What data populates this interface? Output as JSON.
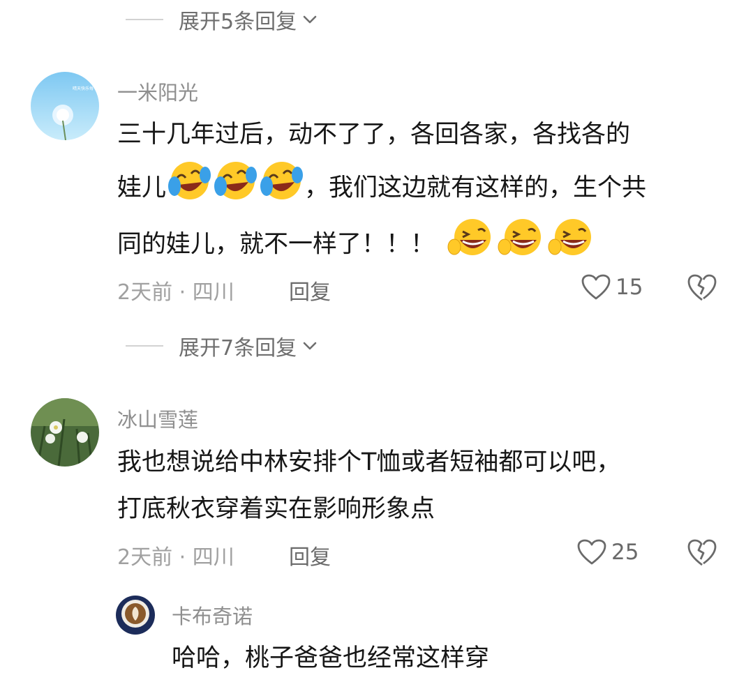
{
  "replies_expand": [
    {
      "label": "展开5条回复"
    },
    {
      "label": "展开7条回复"
    }
  ],
  "comments": [
    {
      "username": "一米阳光",
      "lines": [
        "三十几年过后，动不了了，各回各家，各找各的",
        "，我们这边就有这样的，生个共",
        "同的娃儿，就不一样了！！！"
      ],
      "line2_prefix": "娃儿",
      "meta": "2天前 · 四川",
      "reply": "回复",
      "likes": "15",
      "avatar_caption": "晴天快乐每一天"
    },
    {
      "username": "冰山雪莲",
      "lines": [
        "我也想说给中林安排个T恤或者短袖都可以吧，",
        "打底秋衣穿着实在影响形象点"
      ],
      "meta": "2天前 · 四川",
      "reply": "回复",
      "likes": "25"
    },
    {
      "username": "卡布奇诺",
      "lines": [
        "哈哈，桃子爸爸也经常这样穿"
      ]
    }
  ],
  "icons": {
    "like": "heart-outline-icon",
    "dislike": "broken-heart-icon",
    "expand": "chevron-down-icon",
    "laugh_cry": "tears-of-joy-emoji",
    "grin_wink": "grinning-wink-emoji"
  },
  "colors": {
    "text": "#161616",
    "muted": "#a0a0a0",
    "username": "#8e8e8e",
    "emoji_yellow": "#ffc928"
  }
}
